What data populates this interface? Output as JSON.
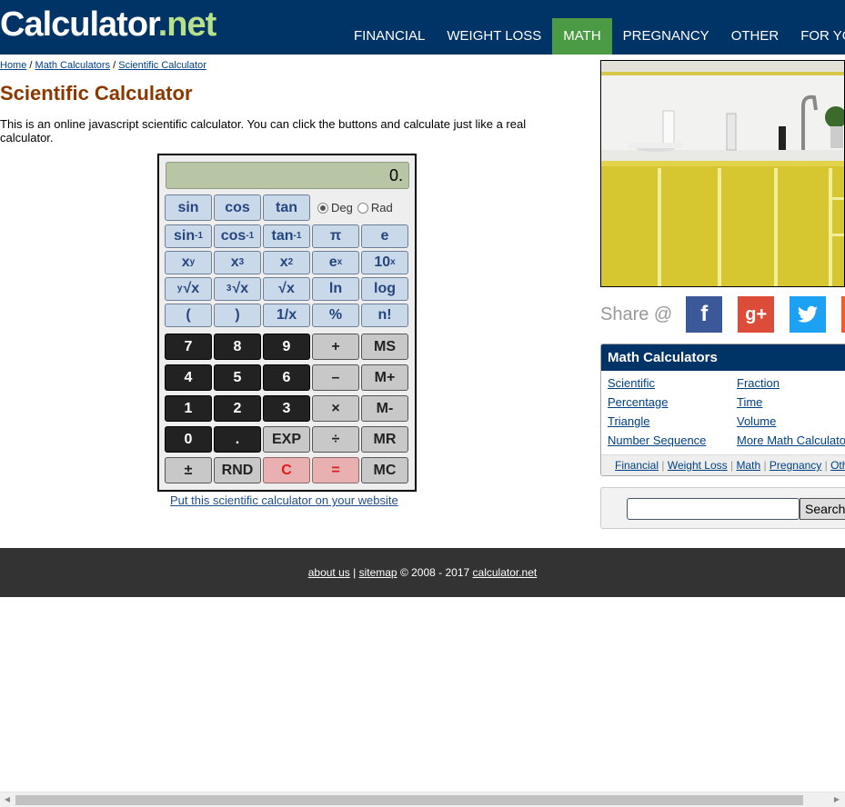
{
  "header": {
    "logo_main": "Calculator",
    "logo_suffix": ".net",
    "nav": [
      "FINANCIAL",
      "WEIGHT LOSS",
      "MATH",
      "PREGNANCY",
      "OTHER",
      "FOR YOUR SI"
    ],
    "active_nav": "MATH",
    "colors": {
      "bar": "#003366",
      "active": "#4b9b45",
      "logo_suffix": "#b6e089"
    }
  },
  "breadcrumb": {
    "items": [
      "Home",
      "Math Calculators",
      "Scientific Calculator"
    ],
    "separator": "/"
  },
  "page": {
    "title": "Scientific Calculator",
    "intro": "This is an online javascript scientific calculator. You can click the buttons and calculate just like a real calculator."
  },
  "calculator": {
    "display": "0.",
    "angle_modes": [
      "Deg",
      "Rad"
    ],
    "selected_mode": "Deg",
    "buttons": {
      "sin": "sin",
      "cos": "cos",
      "tan": "tan",
      "asin": "sin",
      "acos": "cos",
      "atan": "tan",
      "inv_sup": "-1",
      "pi": "π",
      "e": "e",
      "xy_base": "x",
      "xy_sup": "y",
      "x3_base": "x",
      "x3_sup": "3",
      "x2_base": "x",
      "x2_sup": "2",
      "ex_base": "e",
      "ex_sup": "x",
      "tenx_base": "10",
      "tenx_sup": "x",
      "yroot_pre": "y",
      "yroot_body": "√x",
      "croot_pre": "3",
      "croot_body": "√x",
      "sqrt": "√x",
      "ln": "ln",
      "log": "log",
      "lparen": "(",
      "rparen": ")",
      "inv": "1/x",
      "pct": "%",
      "fact": "n!",
      "d7": "7",
      "d8": "8",
      "d9": "9",
      "plus": "+",
      "ms": "MS",
      "d4": "4",
      "d5": "5",
      "d6": "6",
      "minus": "–",
      "mplus": "M+",
      "d1": "1",
      "d2": "2",
      "d3": "3",
      "times": "×",
      "mminus": "M-",
      "d0": "0",
      "dot": ".",
      "exp": "EXP",
      "divide": "÷",
      "mr": "MR",
      "sign": "±",
      "rnd": "RND",
      "clear": "C",
      "equals": "=",
      "mc": "MC"
    }
  },
  "embed_link": "Put this scientific calculator on your website",
  "share": {
    "label": "Share @",
    "networks": [
      "facebook-icon",
      "google-plus-icon",
      "twitter-icon",
      "more-icon"
    ],
    "colors": [
      "#3b5998",
      "#dd4b39",
      "#1da1f2",
      "#ff5722"
    ]
  },
  "math_box": {
    "title": "Math Calculators",
    "links_left": [
      "Scientific",
      "Percentage",
      "Triangle",
      "Number Sequence"
    ],
    "links_right": [
      "Fraction",
      "Time",
      "Volume",
      "More Math Calculato"
    ],
    "footer_links": [
      "Financial",
      "Weight Loss",
      "Math",
      "Pregnancy",
      "Oth"
    ]
  },
  "search": {
    "button": "Search",
    "value": ""
  },
  "footer": {
    "about": "about us",
    "sitemap": "sitemap",
    "copyright": "© 2008 - 2017",
    "site": "calculator.net"
  }
}
